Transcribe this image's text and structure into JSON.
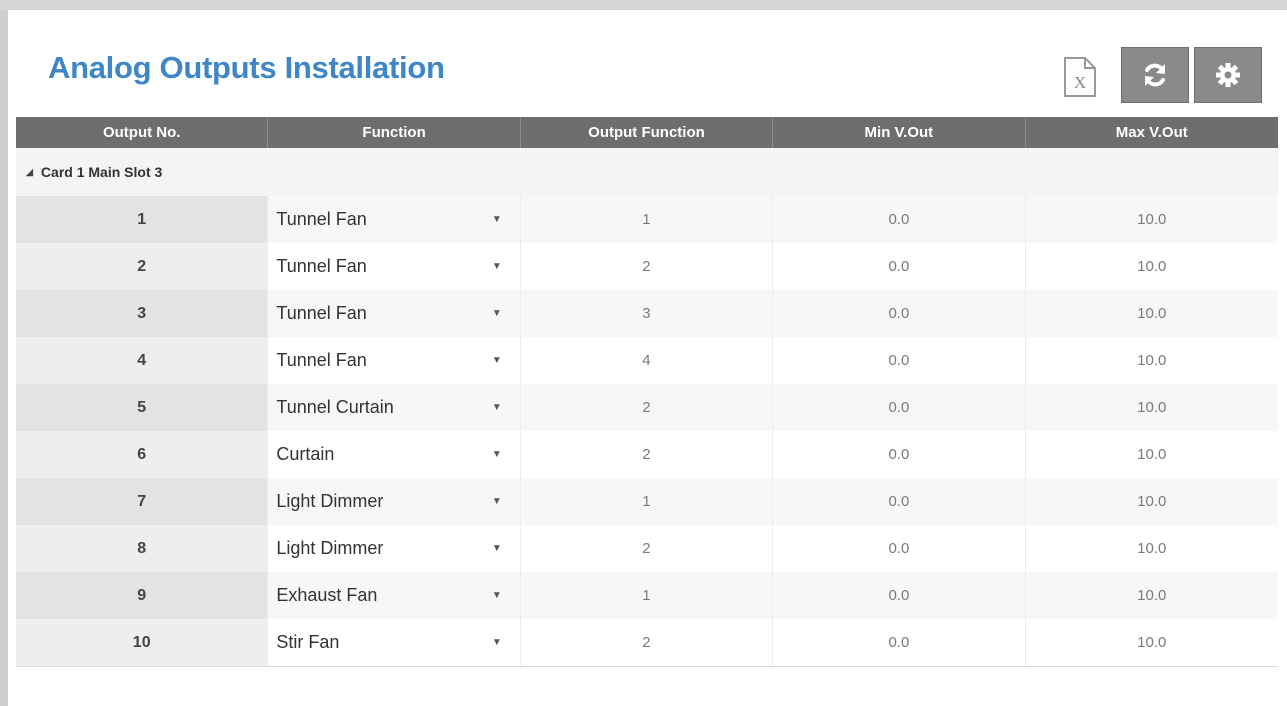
{
  "page": {
    "title": "Analog Outputs Installation"
  },
  "toolbar": {
    "excel_icon": "excel-export-icon",
    "refresh_icon": "refresh-icon",
    "settings_icon": "gear-icon"
  },
  "table": {
    "headers": [
      "Output No.",
      "Function",
      "Output Function",
      "Min V.Out",
      "Max V.Out"
    ],
    "group_label": "Card 1 Main Slot 3",
    "rows": [
      {
        "no": "1",
        "function": "Tunnel Fan",
        "output_function": "1",
        "min": "0.0",
        "max": "10.0"
      },
      {
        "no": "2",
        "function": "Tunnel Fan",
        "output_function": "2",
        "min": "0.0",
        "max": "10.0"
      },
      {
        "no": "3",
        "function": "Tunnel Fan",
        "output_function": "3",
        "min": "0.0",
        "max": "10.0"
      },
      {
        "no": "4",
        "function": "Tunnel Fan",
        "output_function": "4",
        "min": "0.0",
        "max": "10.0"
      },
      {
        "no": "5",
        "function": "Tunnel Curtain",
        "output_function": "2",
        "min": "0.0",
        "max": "10.0"
      },
      {
        "no": "6",
        "function": "Curtain",
        "output_function": "2",
        "min": "0.0",
        "max": "10.0"
      },
      {
        "no": "7",
        "function": "Light Dimmer",
        "output_function": "1",
        "min": "0.0",
        "max": "10.0"
      },
      {
        "no": "8",
        "function": "Light Dimmer",
        "output_function": "2",
        "min": "0.0",
        "max": "10.0"
      },
      {
        "no": "9",
        "function": "Exhaust Fan",
        "output_function": "1",
        "min": "0.0",
        "max": "10.0"
      },
      {
        "no": "10",
        "function": "Stir Fan",
        "output_function": "2",
        "min": "0.0",
        "max": "10.0"
      }
    ]
  },
  "colors": {
    "title": "#3f86c6",
    "header_bg": "#6d6e70",
    "button_bg": "#8a8a8a"
  }
}
